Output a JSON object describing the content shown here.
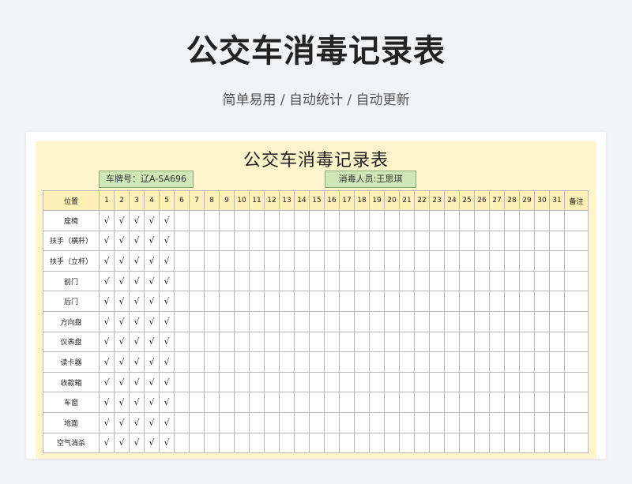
{
  "header": {
    "title": "公交车消毒记录表",
    "subtitle": "简单易用 / 自动统计 / 自动更新"
  },
  "sheet": {
    "title": "公交车消毒记录表",
    "plate_label": "车牌号：辽A-SA696",
    "staff_label": "消毒人员:王思琪",
    "columns": {
      "position": "位置",
      "days": [
        "1",
        "2",
        "3",
        "4",
        "5",
        "6",
        "7",
        "8",
        "9",
        "10",
        "11",
        "12",
        "13",
        "14",
        "15",
        "16",
        "17",
        "18",
        "19",
        "20",
        "21",
        "22",
        "23",
        "24",
        "25",
        "26",
        "27",
        "28",
        "29",
        "30",
        "31"
      ],
      "note": "备注"
    },
    "rows": [
      {
        "position": "座椅",
        "checks": [
          "√",
          "√",
          "√",
          "√",
          "√"
        ]
      },
      {
        "position": "扶手（横杆）",
        "checks": [
          "√",
          "√",
          "√",
          "√",
          "√"
        ]
      },
      {
        "position": "扶手（立杆）",
        "checks": [
          "√",
          "√",
          "√",
          "√",
          "√"
        ]
      },
      {
        "position": "前门",
        "checks": [
          "√",
          "√",
          "√",
          "√",
          "√"
        ]
      },
      {
        "position": "后门",
        "checks": [
          "√",
          "√",
          "√",
          "√",
          "√"
        ]
      },
      {
        "position": "方向盘",
        "checks": [
          "√",
          "√",
          "√",
          "√",
          "√"
        ]
      },
      {
        "position": "仪表盘",
        "checks": [
          "√",
          "√",
          "√",
          "√",
          "√"
        ]
      },
      {
        "position": "读卡器",
        "checks": [
          "√",
          "√",
          "√",
          "√",
          "√"
        ]
      },
      {
        "position": "收款箱",
        "checks": [
          "√",
          "√",
          "√",
          "√",
          "√"
        ]
      },
      {
        "position": "车窗",
        "checks": [
          "√",
          "√",
          "√",
          "√",
          "√"
        ]
      },
      {
        "position": "地面",
        "checks": [
          "√",
          "√",
          "√",
          "√",
          "√"
        ]
      },
      {
        "position": "空气消杀",
        "checks": [
          "√",
          "√",
          "√",
          "√",
          "√"
        ]
      }
    ]
  }
}
